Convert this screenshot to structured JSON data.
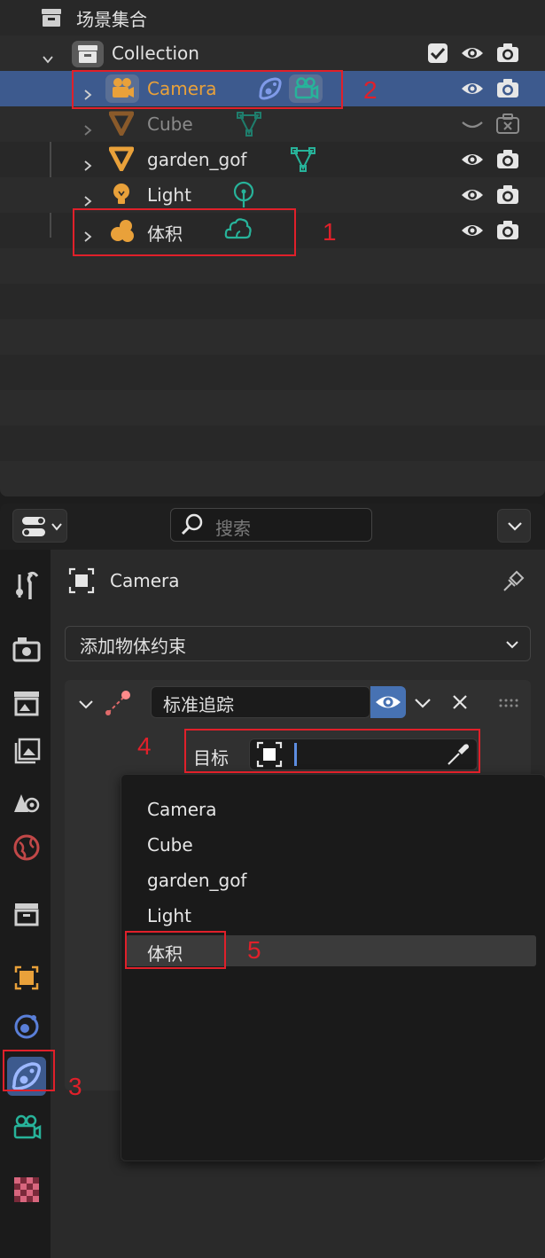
{
  "outliner": {
    "scene_title": "场景集合",
    "collection_label": "Collection",
    "objects": [
      {
        "label": "Camera",
        "color": "#e9a13a"
      },
      {
        "label": "Cube",
        "color": "#8a8a8a"
      },
      {
        "label": "garden_gof",
        "color": "#e2e2e2"
      },
      {
        "label": "Light",
        "color": "#e2e2e2"
      },
      {
        "label": "体积",
        "color": "#e2e2e2"
      }
    ]
  },
  "properties": {
    "search_placeholder": "搜索",
    "object_name": "Camera",
    "add_constraint_label": "添加物体约束",
    "constraint_name": "标准追踪",
    "target_label": "目标",
    "target_value": ""
  },
  "dropdown": {
    "items": [
      "Camera",
      "Cube",
      "garden_gof",
      "Light",
      "体积"
    ],
    "highlighted": "体积"
  },
  "annotations": {
    "n1": "1",
    "n2": "2",
    "n3": "3",
    "n4": "4",
    "n5": "5"
  },
  "colors": {
    "accent_blue": "#4772b3",
    "selection_blue": "#3d5a8e",
    "annotation_red": "#e0202a",
    "object_orange": "#e9a13a",
    "data_green": "#27b39a"
  }
}
